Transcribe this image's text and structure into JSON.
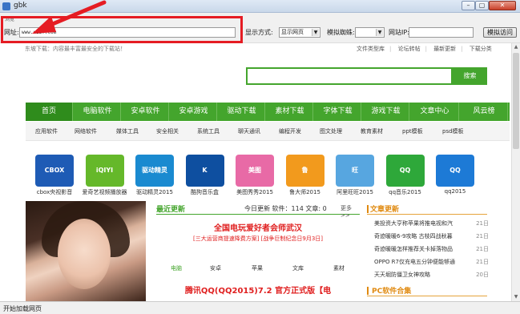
{
  "window": {
    "title": "gbk"
  },
  "toolbar": {
    "group_label": "浏览",
    "url_label": "网址:",
    "url_value": "www.uzzf.com",
    "display_label": "显示方式:",
    "display_value": "显示网页",
    "ua_label": "模拟蜘蛛:",
    "ua_value": "",
    "ip_label": "网站IP:",
    "ip_value": "",
    "visit_button": "模拟访问"
  },
  "page": {
    "tagline": "东坡下载：内容最丰富最安全的下载站！",
    "toplinks": [
      "文件类型库",
      "论坛转帖",
      "最新更新",
      "下载分类"
    ],
    "search_button": "搜索",
    "mainnav": [
      "首页",
      "电脑软件",
      "安卓软件",
      "安卓游戏",
      "驱动下载",
      "素材下载",
      "字体下载",
      "游戏下载",
      "文章中心",
      "风云榜"
    ],
    "subnav": [
      "应用软件",
      "网络软件",
      "媒体工具",
      "安全相关",
      "系统工具",
      "聊天通讯",
      "编程开发",
      "图文处理",
      "教育素材",
      "ppt模板",
      "psd模板"
    ],
    "apps": [
      {
        "caption": "cbox央视影音",
        "color": "#1e5bb5",
        "logo": "CBOX"
      },
      {
        "caption": "爱奇艺视频播放器",
        "color": "#65b82a",
        "logo": "iQIYI"
      },
      {
        "caption": "驱动精灵2015",
        "color": "#1a8ad0",
        "logo": "驱动精灵"
      },
      {
        "caption": "酷狗音乐盒",
        "color": "#0e4fa0",
        "logo": "K"
      },
      {
        "caption": "美图秀秀2015",
        "color": "#e86aa6",
        "logo": "美图"
      },
      {
        "caption": "鲁大师2015",
        "color": "#f29a1d",
        "logo": "鲁"
      },
      {
        "caption": "阿里旺旺2015",
        "color": "#57a6e0",
        "logo": "旺"
      },
      {
        "caption": "qq音乐2015",
        "color": "#2ea83a",
        "logo": "QQ"
      },
      {
        "caption": "qq2015",
        "color": "#1d7ad6",
        "logo": "QQ"
      }
    ],
    "recent": {
      "title": "最近更新",
      "stat": "今日更新 软件：114 文章: 0",
      "more": "更多>>",
      "lead1": "全国电玩爱好者会师武汉",
      "lead2": "[三大运营商提速降费方案] [战争巨制纪念日9月3日]",
      "tabs": [
        "电脑",
        "安卓",
        "苹果",
        "文库",
        "素材"
      ],
      "lead3": "腾讯QQ(QQ2015)7.2 官方正式版【电"
    },
    "news": {
      "title": "文章更新",
      "rows": [
        {
          "title": "美投资大亨称苹果将推电视和汽",
          "date": "21日"
        },
        {
          "title": "奇迹暖暖6-9攻略 古枝四战秋暮",
          "date": "21日"
        },
        {
          "title": "奇迹暖暖怎样推荐关卡掉落物品",
          "date": "21日"
        },
        {
          "title": "OPPO R7仅充电五分钟便能够通",
          "date": "21日"
        },
        {
          "title": "天天堀防僵卫女神攻略",
          "date": "20日"
        }
      ],
      "sub_title": "PC软件合集"
    }
  },
  "status": {
    "text": "开始加载网页"
  }
}
